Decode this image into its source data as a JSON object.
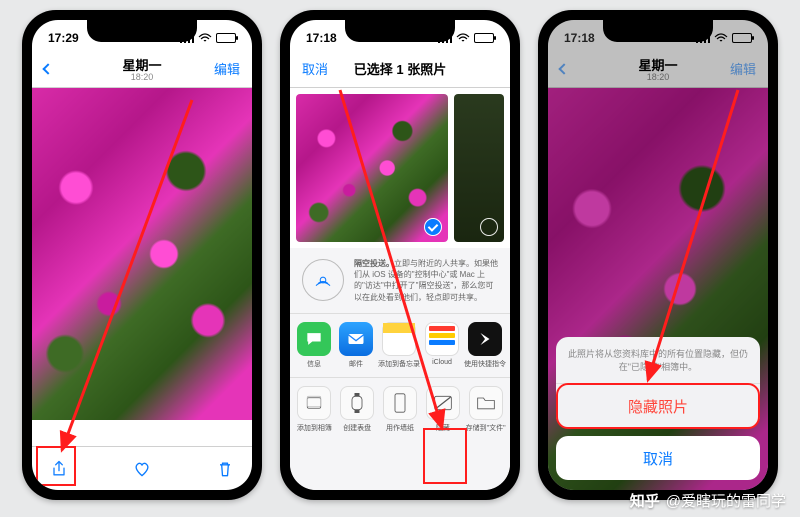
{
  "phone1": {
    "status_time": "17:29",
    "battery_pct": 95,
    "back_label": "",
    "title": "星期一",
    "subtitle": "18:20",
    "edit_label": "编辑",
    "toolbar": {
      "share_icon": "share-icon",
      "heart_icon": "heart-icon",
      "trash_icon": "trash-icon"
    }
  },
  "phone2": {
    "status_time": "17:18",
    "battery_pct": 95,
    "cancel_label": "取消",
    "title": "已选择 1 张照片",
    "airdrop": {
      "title": "隔空投送。",
      "body": "立即与附近的人共享。如果他们从 iOS 设备的\"控制中心\"或 Mac 上的\"访达\"中打开了\"隔空投送\"，那么您可以在此处看到他们，轻点即可共享。"
    },
    "apps": [
      {
        "label": "信息",
        "color": "#34c759"
      },
      {
        "label": "邮件",
        "color": "#1b84ff"
      },
      {
        "label": "添加到备忘录",
        "color": "#ffd33d"
      },
      {
        "label": "iCloud",
        "color": "linear"
      },
      {
        "label": "使用快捷指令",
        "color": "#111"
      }
    ],
    "actions": [
      {
        "label": "添加到相簿",
        "icon": "album"
      },
      {
        "label": "创建表盘",
        "icon": "watch"
      },
      {
        "label": "用作墙纸",
        "icon": "wallpaper"
      },
      {
        "label": "隐藏",
        "icon": "hide"
      },
      {
        "label": "存储到\"文件\"",
        "icon": "folder"
      }
    ]
  },
  "phone3": {
    "status_time": "17:18",
    "battery_pct": 95,
    "title": "星期一",
    "subtitle": "18:20",
    "edit_label": "编辑",
    "sheet_hint": "此照片将从您资料库中的所有位置隐藏，但仍在\"已隐藏\"相簿中。",
    "hide_photo_label": "隐藏照片",
    "cancel_label": "取消"
  },
  "watermark": {
    "logo_text": "知乎",
    "author": "@爱瞎玩的雷同学"
  }
}
